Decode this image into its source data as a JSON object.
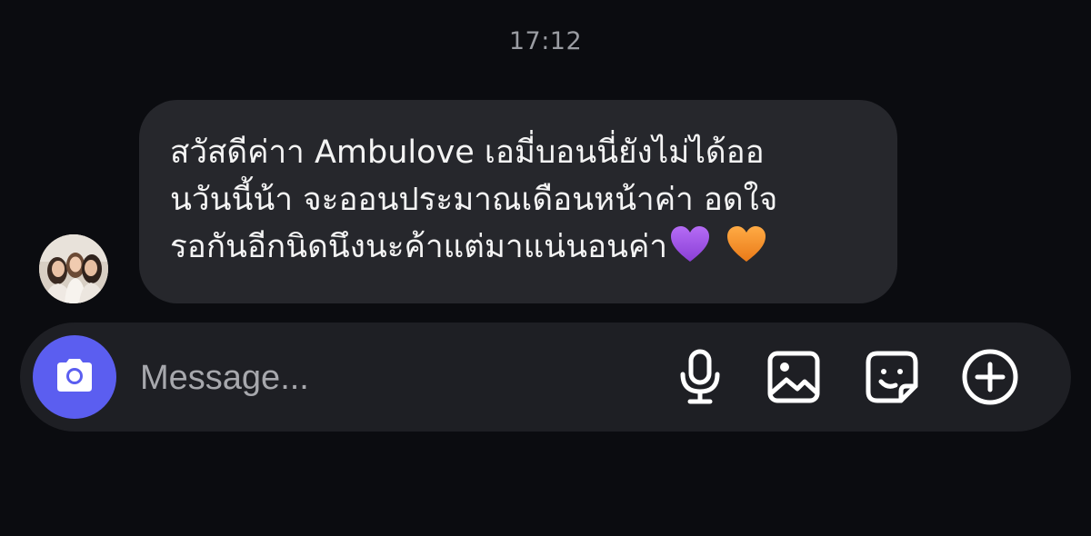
{
  "chat": {
    "timestamp": "17:12",
    "message": {
      "lines": [
        "สวัสดีค่าา Ambulove เอมี่บอนนี่ยังไม่ได้ออ",
        "นวันนี้น้า จะออนประมาณเดือนหน้าค่า อดใจ",
        "รอกันอีกนิดนึงนะค้าแต่มาแน่นอนค่า"
      ],
      "emojis": [
        "purple-heart",
        "orange-heart"
      ],
      "sender_avatar": "three-people-photo"
    }
  },
  "composer": {
    "placeholder": "Message...",
    "icons": [
      "camera-icon",
      "microphone-icon",
      "image-icon",
      "sticker-icon",
      "plus-icon"
    ]
  },
  "colors": {
    "background": "#0b0c10",
    "bubble": "#26272c",
    "composer": "#1e1f24",
    "camera_button": "#5b5ef0",
    "purple_heart": "#9b51e0",
    "orange_heart": "#f08a24"
  }
}
